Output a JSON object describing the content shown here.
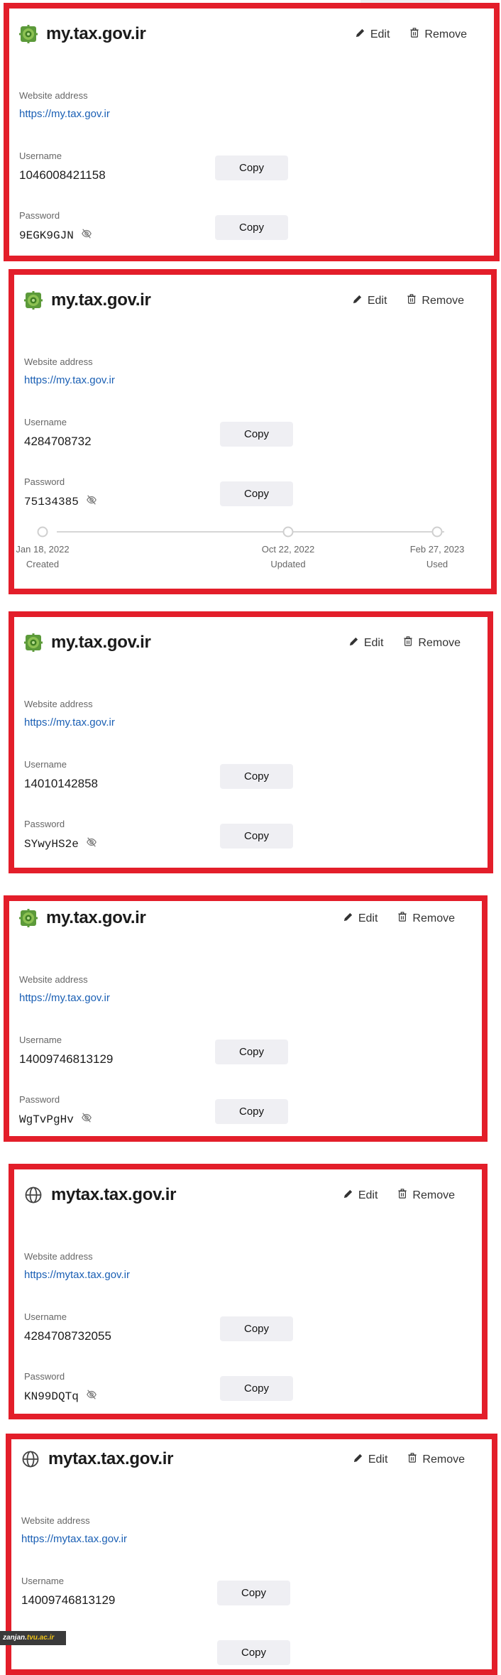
{
  "labels": {
    "edit": "Edit",
    "remove": "Remove",
    "website_address": "Website address",
    "username": "Username",
    "password": "Password",
    "copy": "Copy"
  },
  "colors": {
    "highlight_border": "#e31e2a",
    "link": "#1a5fb4",
    "copy_button_bg": "#efeff3"
  },
  "cards": [
    {
      "title": "my.tax.gov.ir",
      "icon": "tax-logo-icon",
      "url": "https://my.tax.gov.ir",
      "username": "1046008421158",
      "password": "9EGK9GJN"
    },
    {
      "title": "my.tax.gov.ir",
      "icon": "tax-logo-icon",
      "url": "https://my.tax.gov.ir",
      "username": "4284708732",
      "password": "75134385",
      "timeline": [
        {
          "date": "Jan 18, 2022",
          "label": "Created"
        },
        {
          "date": "Oct 22, 2022",
          "label": "Updated"
        },
        {
          "date": "Feb 27, 2023",
          "label": "Used"
        }
      ]
    },
    {
      "title": "my.tax.gov.ir",
      "icon": "tax-logo-icon",
      "url": "https://my.tax.gov.ir",
      "username": "14010142858",
      "password": "SYwyHS2e"
    },
    {
      "title": "my.tax.gov.ir",
      "icon": "tax-logo-icon",
      "url": "https://my.tax.gov.ir",
      "username": "14009746813129",
      "password": "WgTvPgHv"
    },
    {
      "title": "mytax.tax.gov.ir",
      "icon": "globe-icon",
      "url": "https://mytax.tax.gov.ir",
      "username": "4284708732055",
      "password": "KN99DQTq"
    },
    {
      "title": "mytax.tax.gov.ir",
      "icon": "globe-icon",
      "url": "https://mytax.tax.gov.ir",
      "username": "14009746813129"
    }
  ],
  "watermark": {
    "part1": "zanjan.",
    "part2": "tvu.ac.ir"
  }
}
